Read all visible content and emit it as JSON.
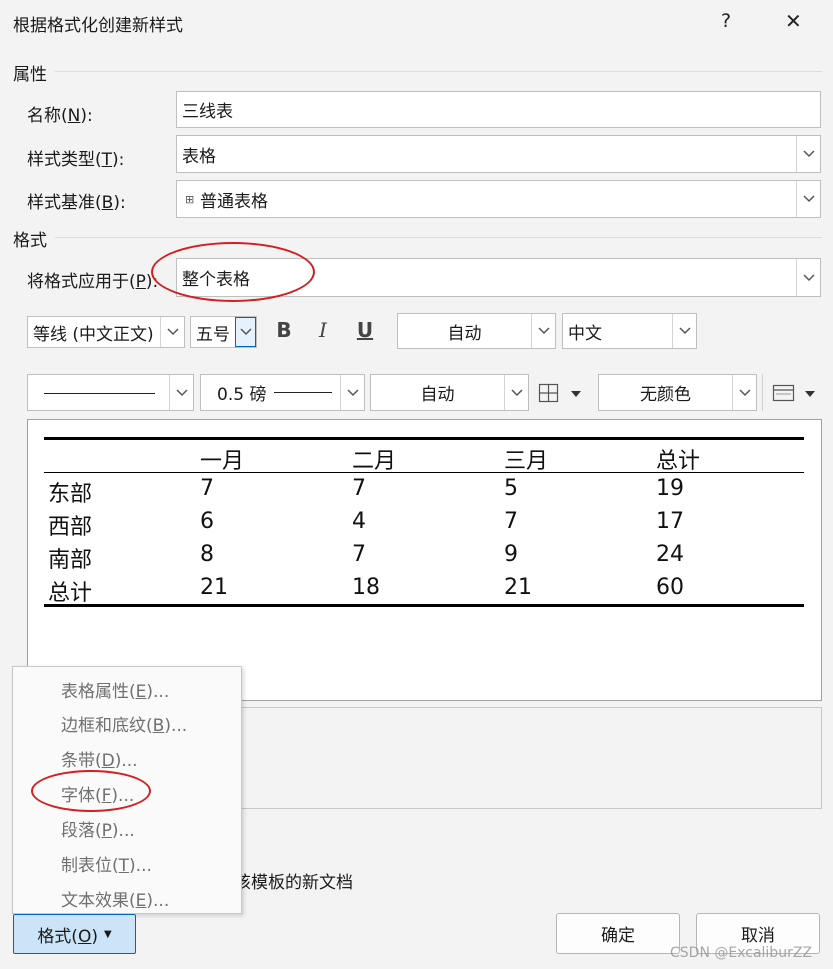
{
  "window": {
    "title": "根据格式化创建新样式",
    "help": "?",
    "close": "✕"
  },
  "properties": {
    "heading": "属性",
    "name_label": "名称(N):",
    "name_value": "三线表",
    "type_label": "样式类型(T):",
    "type_value": "表格",
    "base_label": "样式基准(B):",
    "base_value": "普通表格"
  },
  "format": {
    "heading": "格式",
    "apply_label": "将格式应用于(P):",
    "apply_value": "整个表格",
    "font": "等线 (中文正文)",
    "size": "五号",
    "bold": "B",
    "italic": "I",
    "underline": "U",
    "color": "自动",
    "script": "中文",
    "line_style": "",
    "line_weight": "0.5 磅",
    "border_color": "自动",
    "shading": "无颜色"
  },
  "preview": {
    "headers": [
      "",
      "一月",
      "二月",
      "三月",
      "总计"
    ],
    "rows": [
      [
        "东部",
        "7",
        "7",
        "5",
        "19"
      ],
      [
        "西部",
        "6",
        "4",
        "7",
        "17"
      ],
      [
        "南部",
        "8",
        "7",
        "9",
        "24"
      ],
      [
        "总计",
        "21",
        "18",
        "21",
        "60"
      ]
    ]
  },
  "menu": {
    "items": [
      "表格属性(E)...",
      "边框和底纹(B)...",
      "条带(D)...",
      "字体(F)...",
      "段落(P)...",
      "制表位(T)...",
      "文本效果(E)..."
    ]
  },
  "partial_text": "该模板的新文档",
  "buttons": {
    "format": "格式(O)",
    "ok": "确定",
    "cancel": "取消"
  },
  "watermark": "CSDN @ExcaliburZZ",
  "colors": {
    "annotation": "#d21f1f",
    "accent": "#0067c0"
  }
}
